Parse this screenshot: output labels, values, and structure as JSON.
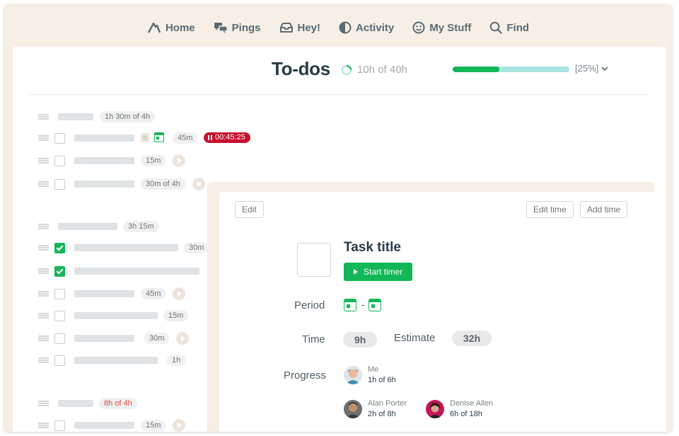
{
  "nav": {
    "items": [
      {
        "label": "Home",
        "icon": "home-icon"
      },
      {
        "label": "Pings",
        "icon": "pings-icon"
      },
      {
        "label": "Hey!",
        "icon": "hey-icon"
      },
      {
        "label": "Activity",
        "icon": "activity-icon"
      },
      {
        "label": "My Stuff",
        "icon": "smiley-icon"
      },
      {
        "label": "Find",
        "icon": "search-icon"
      }
    ]
  },
  "header": {
    "title": "To-dos",
    "hours": "10h of 40h",
    "progress_percent": 25,
    "progress_label": "[25%]"
  },
  "colors": {
    "accent_green": "#12b757",
    "progress_track": "#a9e5e0",
    "timer_red": "#c8102e",
    "frame_beige": "#f5efe6"
  },
  "groups": [
    {
      "time": "1h 30m of 4h",
      "over": false
    },
    {
      "time": "3h 15m",
      "over": false
    },
    {
      "time": "8h of 4h",
      "over": true
    }
  ],
  "tasks": [
    {
      "time": "45m",
      "timer": "00:45:25",
      "checked": false
    },
    {
      "time": "15m",
      "checked": false
    },
    {
      "time": "30m of 4h",
      "checked": false
    },
    {
      "time": "30m",
      "checked": true
    },
    {
      "time": "",
      "checked": true
    },
    {
      "time": "45m",
      "checked": false
    },
    {
      "time": "15m",
      "checked": false
    },
    {
      "time": "30m",
      "checked": false
    },
    {
      "time": "1h",
      "checked": false
    },
    {
      "time": "15m",
      "checked": false
    }
  ],
  "panel": {
    "edit_label": "Edit",
    "edit_time_label": "Edit time",
    "add_time_label": "Add time",
    "task_title": "Task title",
    "start_timer_label": "Start timer",
    "period_label": "Period",
    "period_separator": "-",
    "time_label": "Time",
    "time_value": "9h",
    "estimate_label": "Estimate",
    "estimate_value": "32h",
    "progress_label": "Progress",
    "people": [
      {
        "name": "Me",
        "hours": "1h of 6h"
      },
      {
        "name": "Alan Porter",
        "hours": "2h of 8h"
      },
      {
        "name": "Denise Allen",
        "hours": "6h of 18h"
      }
    ]
  }
}
